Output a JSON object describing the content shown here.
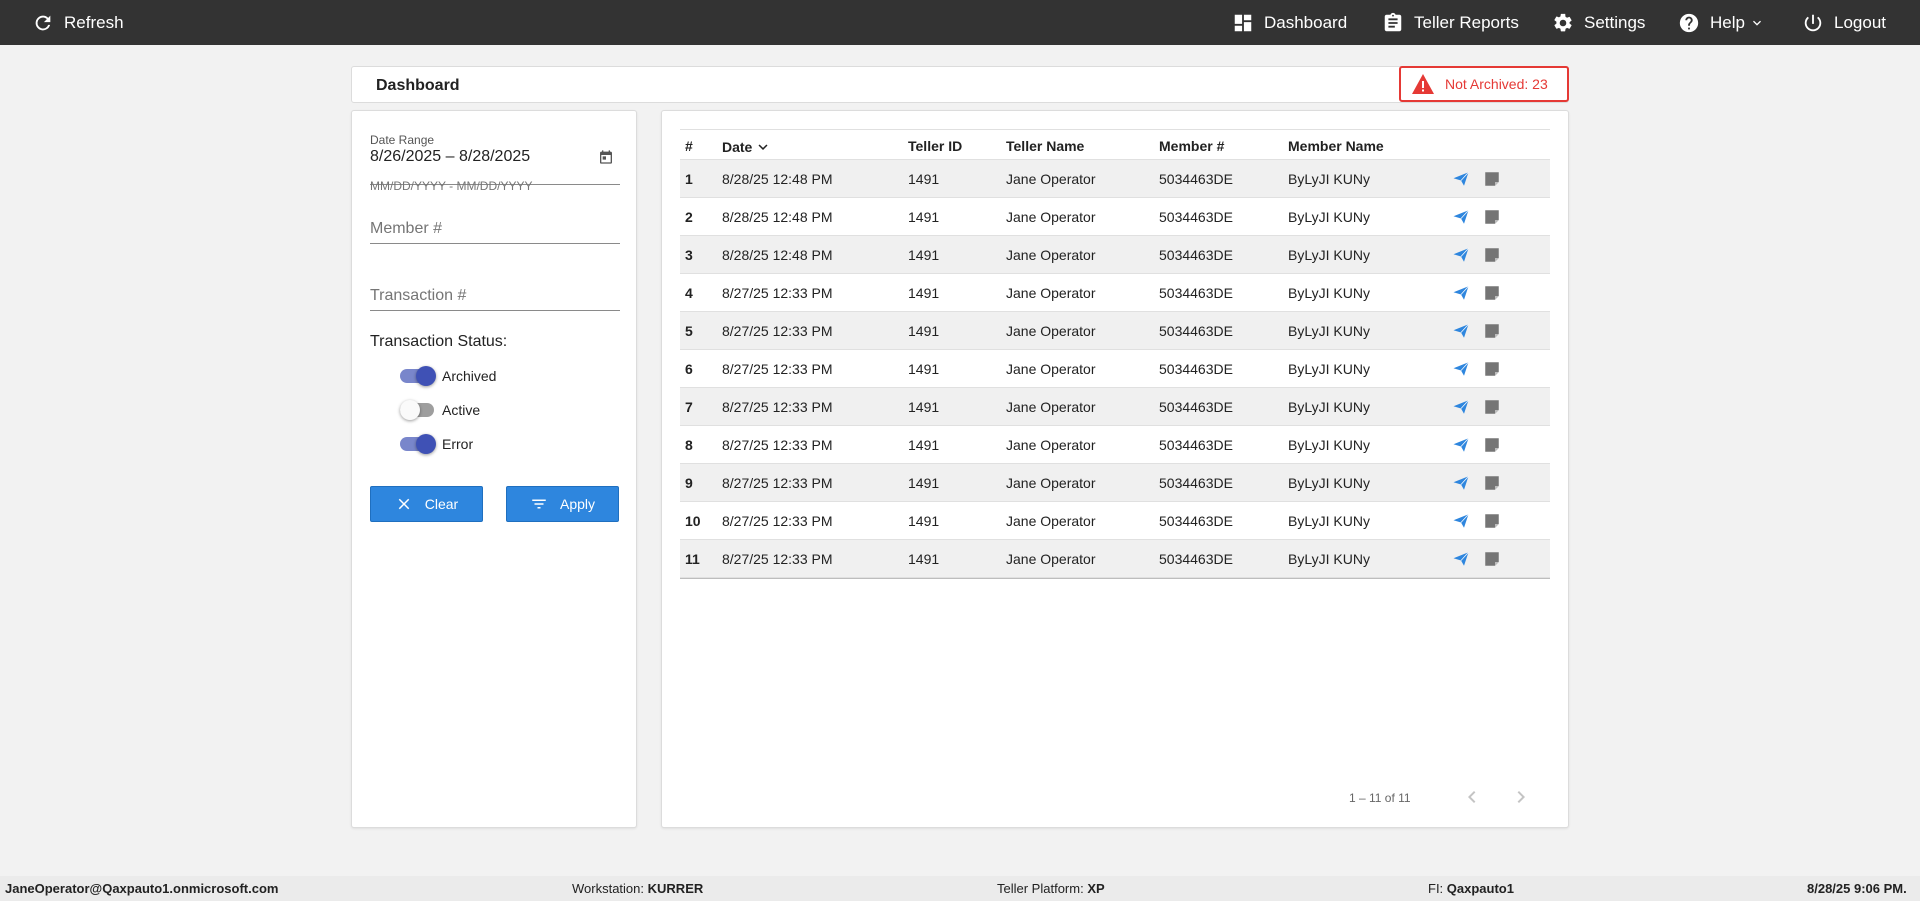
{
  "nav": {
    "refresh": "Refresh",
    "dashboard": "Dashboard",
    "teller_reports": "Teller Reports",
    "settings": "Settings",
    "help": "Help",
    "logout": "Logout"
  },
  "header": {
    "title": "Dashboard",
    "alert": "Not Archived: 23",
    "alert_color": "#e53935"
  },
  "filters": {
    "date_range_label": "Date Range",
    "date_range_value": "8/26/2025 – 8/28/2025",
    "date_hint": "MM/DD/YYYY - MM/DD/YYYY",
    "member_placeholder": "Member #",
    "transaction_placeholder": "Transaction #",
    "status_label": "Transaction Status:",
    "statuses": [
      {
        "label": "Archived",
        "on": true
      },
      {
        "label": "Active",
        "on": false
      },
      {
        "label": "Error",
        "on": true
      }
    ],
    "clear_label": "Clear",
    "apply_label": "Apply"
  },
  "table": {
    "columns": [
      "#",
      "Date",
      "Teller ID",
      "Teller Name",
      "Member #",
      "Member Name"
    ],
    "rows": [
      {
        "num": "1",
        "date": "8/28/25 12:48 PM",
        "teller_id": "1491",
        "teller_name": "Jane Operator",
        "member": "5034463DE",
        "member_name": "ByLyJI KUNy"
      },
      {
        "num": "2",
        "date": "8/28/25 12:48 PM",
        "teller_id": "1491",
        "teller_name": "Jane Operator",
        "member": "5034463DE",
        "member_name": "ByLyJI KUNy"
      },
      {
        "num": "3",
        "date": "8/28/25 12:48 PM",
        "teller_id": "1491",
        "teller_name": "Jane Operator",
        "member": "5034463DE",
        "member_name": "ByLyJI KUNy"
      },
      {
        "num": "4",
        "date": "8/27/25 12:33 PM",
        "teller_id": "1491",
        "teller_name": "Jane Operator",
        "member": "5034463DE",
        "member_name": "ByLyJI KUNy"
      },
      {
        "num": "5",
        "date": "8/27/25 12:33 PM",
        "teller_id": "1491",
        "teller_name": "Jane Operator",
        "member": "5034463DE",
        "member_name": "ByLyJI KUNy"
      },
      {
        "num": "6",
        "date": "8/27/25 12:33 PM",
        "teller_id": "1491",
        "teller_name": "Jane Operator",
        "member": "5034463DE",
        "member_name": "ByLyJI KUNy"
      },
      {
        "num": "7",
        "date": "8/27/25 12:33 PM",
        "teller_id": "1491",
        "teller_name": "Jane Operator",
        "member": "5034463DE",
        "member_name": "ByLyJI KUNy"
      },
      {
        "num": "8",
        "date": "8/27/25 12:33 PM",
        "teller_id": "1491",
        "teller_name": "Jane Operator",
        "member": "5034463DE",
        "member_name": "ByLyJI KUNy"
      },
      {
        "num": "9",
        "date": "8/27/25 12:33 PM",
        "teller_id": "1491",
        "teller_name": "Jane Operator",
        "member": "5034463DE",
        "member_name": "ByLyJI KUNy"
      },
      {
        "num": "10",
        "date": "8/27/25 12:33 PM",
        "teller_id": "1491",
        "teller_name": "Jane Operator",
        "member": "5034463DE",
        "member_name": "ByLyJI KUNy"
      },
      {
        "num": "11",
        "date": "8/27/25 12:33 PM",
        "teller_id": "1491",
        "teller_name": "Jane Operator",
        "member": "5034463DE",
        "member_name": "ByLyJI KUNy"
      }
    ],
    "pagination": "1 – 11 of 11"
  },
  "footer": {
    "user": "JaneOperator@Qaxpauto1.onmicrosoft.com",
    "workstation_label": "Workstation:",
    "workstation": "KURRER",
    "platform_label": "Teller Platform:",
    "platform": "XP",
    "fi_label": "FI:",
    "fi": "Qaxpauto1",
    "datetime": "8/28/25 9:06 PM."
  },
  "colors": {
    "topbar": "#333333",
    "accent": "#2e86de",
    "toggle_on": "#3f51b5"
  }
}
